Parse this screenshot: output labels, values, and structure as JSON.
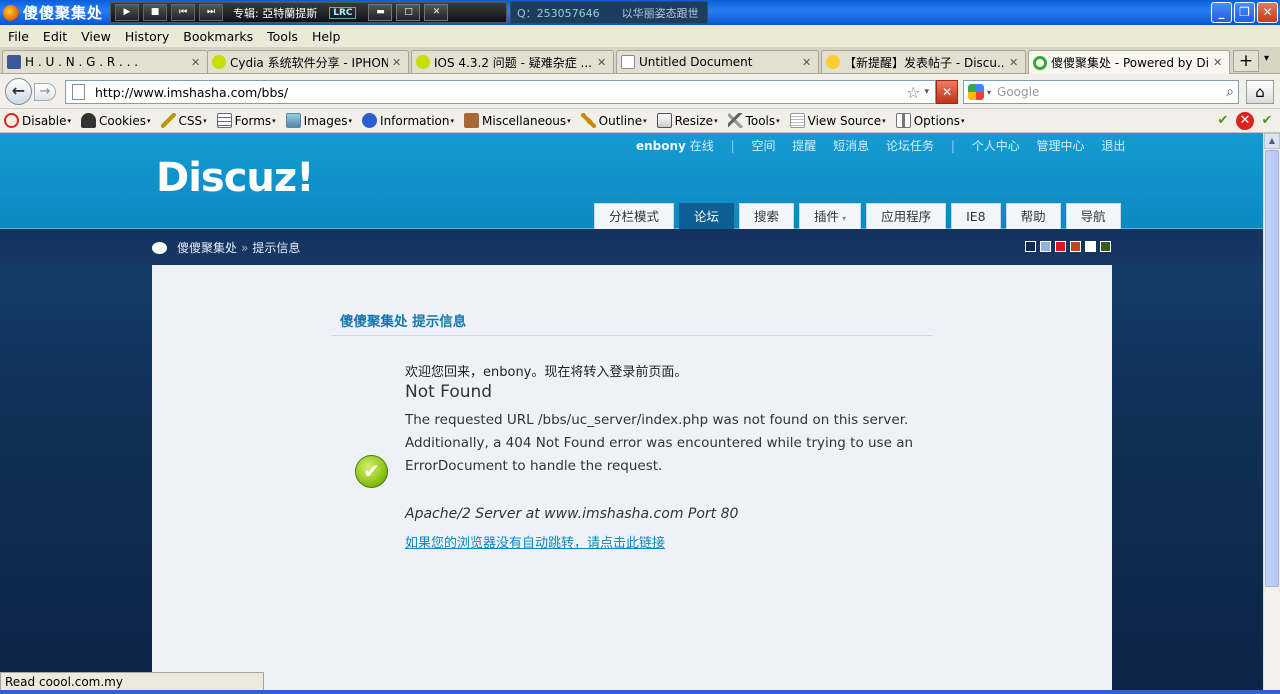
{
  "window": {
    "title": "傻傻聚集处",
    "player": {
      "album_text": "专辑: 亞特蘭提斯",
      "lrc_label": "LRC",
      "buttons": [
        "▶",
        "■",
        "⏮",
        "⏭"
      ],
      "window_buttons": [
        "▬",
        "□",
        "✕"
      ]
    },
    "qq": {
      "number": "Q：253057646",
      "signature": "以华丽姿态跟世"
    },
    "controls": [
      "_",
      "❐",
      "✕"
    ]
  },
  "menubar": [
    "File",
    "Edit",
    "View",
    "History",
    "Bookmarks",
    "Tools",
    "Help"
  ],
  "tabs": [
    {
      "label": "H . U . N . G . R . . .",
      "icon": "facebook-icon",
      "color": "#3b5998"
    },
    {
      "label": "Cydia 系统软件分享 - IPHON...",
      "icon": "loading-icon",
      "color": "#c8e000"
    },
    {
      "label": "IOS 4.3.2 问题 - 疑难杂症 ...",
      "icon": "loading-icon",
      "color": "#c8e000"
    },
    {
      "label": "Untitled Document",
      "icon": "page-icon",
      "color": "#ffffff"
    },
    {
      "label": "【新提醒】发表帖子 - Discu...",
      "icon": "smiley-icon",
      "color": "#ffcc33"
    },
    {
      "label": "傻傻聚集处 - Powered by Di...",
      "icon": "spinner-icon",
      "color": "#33aa33"
    }
  ],
  "tab_close_glyph": "✕",
  "tab_plus": "+",
  "tab_arrow": "▾",
  "nav": {
    "back": "←",
    "forward": "→",
    "url": "http://www.imshasha.com/bbs/",
    "star": "☆",
    "url_dropdown": "▾",
    "stop": "✕",
    "search_placeholder": "Google",
    "search_dropdown": "▾",
    "search_icon": "⌕",
    "home": "⌂"
  },
  "devtoolbar": {
    "items": [
      {
        "label": "Disable",
        "icon": "disable-icon",
        "color": "#d22"
      },
      {
        "label": "Cookies",
        "icon": "cookies-icon",
        "color": "#333"
      },
      {
        "label": "CSS",
        "icon": "css-icon",
        "color": "#b90"
      },
      {
        "label": "Forms",
        "icon": "forms-icon",
        "color": "#667"
      },
      {
        "label": "Images",
        "icon": "images-icon",
        "color": "#58a"
      },
      {
        "label": "Information",
        "icon": "information-icon",
        "color": "#2a5fd0"
      },
      {
        "label": "Miscellaneous",
        "icon": "miscellaneous-icon",
        "color": "#a63"
      },
      {
        "label": "Outline",
        "icon": "outline-icon",
        "color": "#c80"
      },
      {
        "label": "Resize",
        "icon": "resize-icon",
        "color": "#555"
      },
      {
        "label": "Tools",
        "icon": "tools-icon",
        "color": "#666"
      },
      {
        "label": "View Source",
        "icon": "view-source-icon",
        "color": "#999"
      },
      {
        "label": "Options",
        "icon": "options-icon",
        "color": "#777"
      }
    ],
    "dropdown_glyph": "▾",
    "status_icons": [
      {
        "glyph": "✔",
        "color": "#4a9a1a"
      },
      {
        "glyph": "✕",
        "color": "#d22"
      },
      {
        "glyph": "✔",
        "color": "#4a9a1a"
      }
    ]
  },
  "forum": {
    "usernav": {
      "username": "enbony",
      "online": "在线",
      "divider": "|",
      "links_a": [
        "空间",
        "提醒",
        "短消息",
        "论坛任务"
      ],
      "links_b": [
        "个人中心",
        "管理中心",
        "退出"
      ]
    },
    "logo": "Discuz!",
    "mainnav": [
      {
        "label": "分栏模式",
        "active": false,
        "dropdown": false
      },
      {
        "label": "论坛",
        "active": true,
        "dropdown": false
      },
      {
        "label": "搜索",
        "active": false,
        "dropdown": false
      },
      {
        "label": "插件",
        "active": false,
        "dropdown": true
      },
      {
        "label": "应用程序",
        "active": false,
        "dropdown": false
      },
      {
        "label": "IE8",
        "active": false,
        "dropdown": false
      },
      {
        "label": "帮助",
        "active": false,
        "dropdown": false
      },
      {
        "label": "导航",
        "active": false,
        "dropdown": false
      }
    ],
    "mainnav_dropdown_glyph": "▾",
    "breadcrumb": {
      "home": "傻傻聚集处",
      "separator": "»",
      "current": "提示信息"
    },
    "swatches": [
      "#0c2a52",
      "#8fb3d9",
      "#d61a1a",
      "#c4451a",
      "#ffffff",
      "#3a5a1a"
    ],
    "message": {
      "title": "傻傻聚集处 提示信息",
      "ok_glyph": "✔",
      "welcome": "欢迎您回来，enbony。现在将转入登录前页面。",
      "not_found": "Not Found",
      "para1": "The requested URL /bbs/uc_server/index.php was not found on this server.",
      "para2": "Additionally, a 404 Not Found error was encountered while trying to use an ErrorDocument to handle the request.",
      "server": "Apache/2 Server at www.imshasha.com Port 80",
      "redirect_link": "如果您的浏览器没有自动跳转，请点击此链接"
    }
  },
  "scrollbar_up": "▲",
  "statusbar": "Read coool.com.my"
}
